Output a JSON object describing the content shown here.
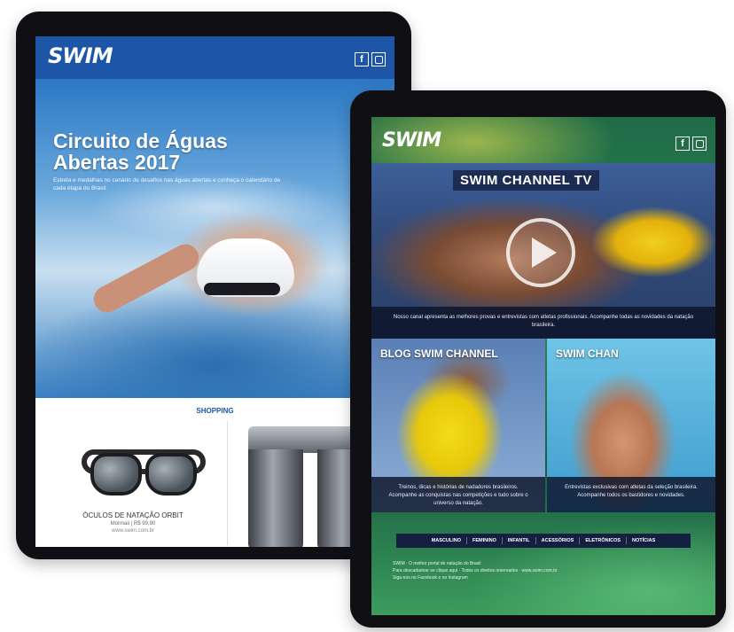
{
  "back": {
    "logo": "SWIM",
    "logo_sub": "",
    "social": {
      "facebook": "f"
    },
    "hero": {
      "title": "Circuito de Águas Abertas 2017",
      "description": "Estrela e medalhas no cenário de desafios nas águas abertas e conheça o calendário de cada etapa do Brasil."
    },
    "shop": {
      "title": "SHOPPING",
      "product_name": "ÓCULOS DE NATAÇÃO ORBIT",
      "product_price": "Mormaii | R$ 99,90",
      "product_link": "www.swim.com.br"
    }
  },
  "front": {
    "logo": "SWIM",
    "social": {
      "facebook": "f"
    },
    "video": {
      "title": "SWIM CHANNEL TV",
      "description": "Nosso canal apresenta as melhores provas e entrevistas com atletas profissionais. Acompanhe todas as novidades da natação brasileira."
    },
    "cards": [
      {
        "title": "BLOG SWIM CHANNEL",
        "description": "Treinos, dicas e histórias de nadadores brasileiros. Acompanhe as conquistas nas competições e tudo sobre o universo da natação."
      },
      {
        "title": "SWIM CHAN",
        "description": "Entrevistas exclusivas com atletas da seleção brasileira. Acompanhe todos os bastidores e novidades."
      }
    ],
    "menu": [
      "MASCULINO",
      "FEMININO",
      "INFANTIL",
      "ACESSÓRIOS",
      "ELETRÔNICOS",
      "NOTÍCIAS"
    ],
    "footer": [
      "SWIM · O melhor portal de natação do Brasil",
      "Para descadastrar-se clique aqui · Todos os direitos reservados · www.swim.com.br",
      "Siga-nos no Facebook e no Instagram"
    ]
  }
}
